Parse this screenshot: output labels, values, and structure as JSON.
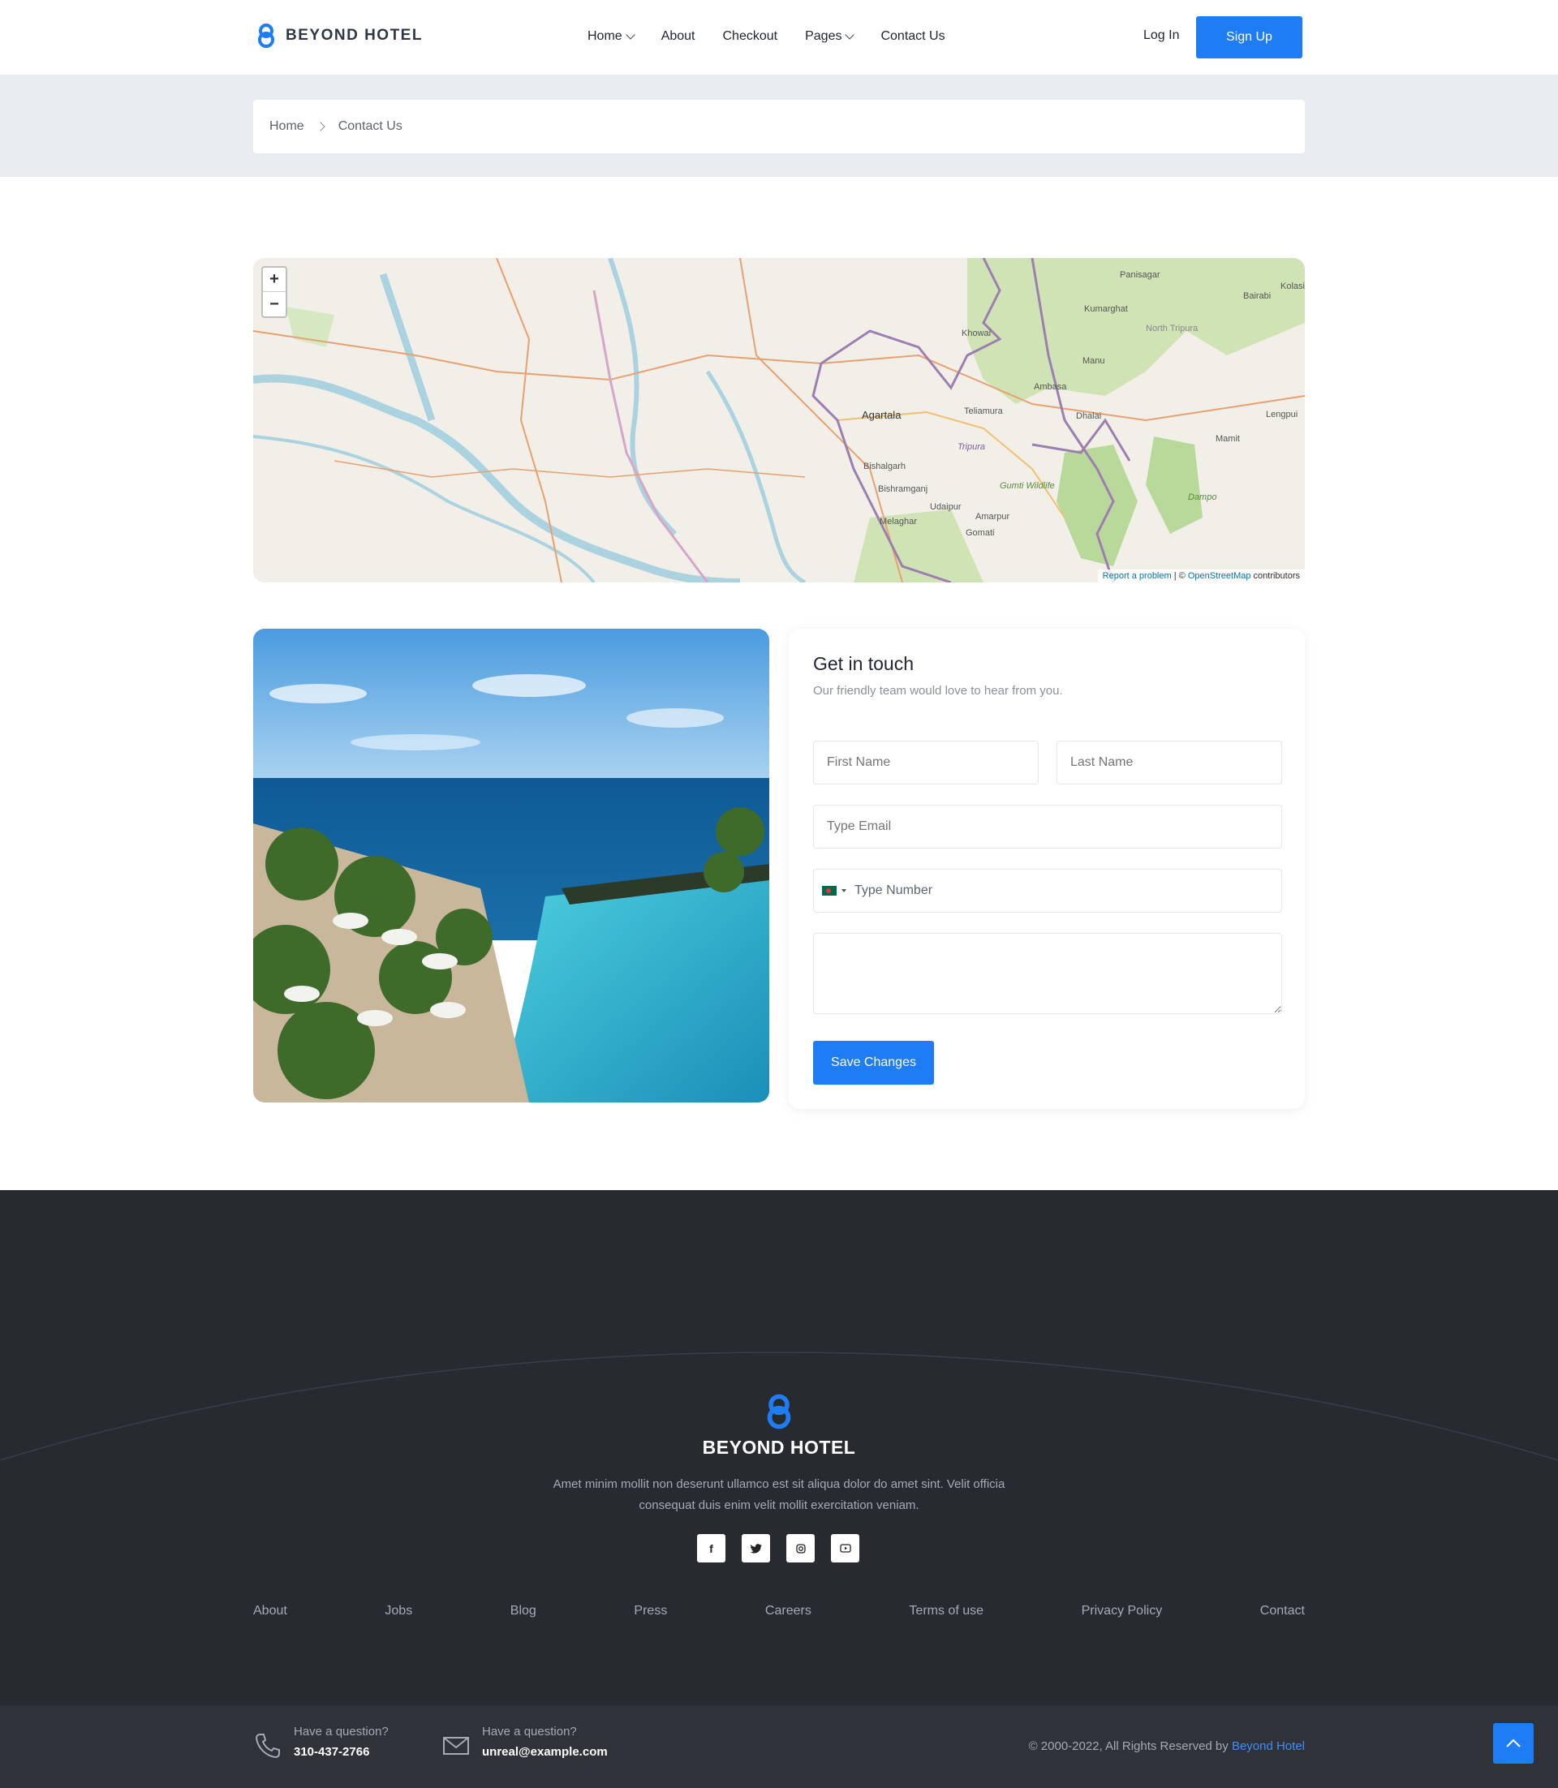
{
  "header": {
    "brand": "BEYOND HOTEL",
    "nav": [
      {
        "label": "Home",
        "dropdown": true
      },
      {
        "label": "About",
        "dropdown": false
      },
      {
        "label": "Checkout",
        "dropdown": false
      },
      {
        "label": "Pages",
        "dropdown": true
      },
      {
        "label": "Contact Us",
        "dropdown": false
      }
    ],
    "login_label": "Log In",
    "signup_label": "Sign Up"
  },
  "breadcrumb": {
    "home": "Home",
    "current": "Contact Us"
  },
  "map": {
    "zoom_in": "+",
    "zoom_out": "−",
    "attribution_report": "Report a problem",
    "attribution_sep": " | © ",
    "attribution_osm": "OpenStreetMap",
    "attribution_tail": " contributors",
    "place_labels": [
      "Agartala",
      "Tripura",
      "Khowai",
      "Ambasa",
      "Teliamura",
      "Bishalgarh",
      "Udaipur",
      "Amarpur",
      "Melaghar",
      "Manu",
      "Mamit",
      "Lengpui",
      "Kumarghat",
      "Panisagar",
      "Bairabi",
      "Kolasib",
      "Bishramganj",
      "Gomati",
      "Dhalai",
      "Gumti Wildlife Sanctuary",
      "Dampa Tiger Reserve",
      "North Tripura"
    ]
  },
  "contact_form": {
    "title": "Get in touch",
    "subtitle": "Our friendly team would love to hear from you.",
    "first_name_placeholder": "First Name",
    "last_name_placeholder": "Last Name",
    "email_placeholder": "Type Email",
    "phone_placeholder": "Type Number",
    "message_placeholder": "",
    "submit_label": "Save Changes"
  },
  "footer": {
    "brand": "BEYOND HOTEL",
    "description": "Amet minim mollit non deserunt ullamco est sit aliqua dolor do amet sint. Velit officia consequat duis enim velit mollit exercitation veniam.",
    "socials": [
      "facebook-icon",
      "twitter-icon",
      "instagram-icon",
      "youtube-icon"
    ],
    "links": [
      "About",
      "Jobs",
      "Blog",
      "Press",
      "Careers",
      "Terms of use",
      "Privacy Policy",
      "Contact"
    ],
    "phone_label": "Have a question?",
    "phone": "310-437-2766",
    "email_label": "Have a question?",
    "email": "unreal@example.com",
    "copyright": "© 2000-2022, All Rights Reserved by ",
    "copyright_brand": "Beyond Hotel"
  },
  "colors": {
    "accent": "#1e7df5",
    "footer_bg": "#272a2f",
    "breadcrumb_bg": "#e8ebef"
  }
}
